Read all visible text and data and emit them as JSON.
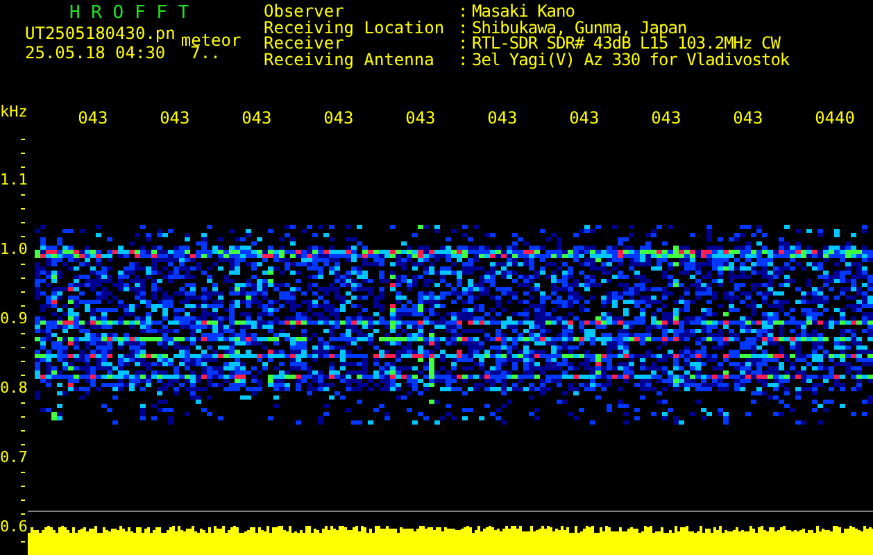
{
  "header": {
    "title": "H R O F F T",
    "file_name": "UT2505180430.pn",
    "event_type": "meteor",
    "date_time": "25.05.18 04:30",
    "count": "7.."
  },
  "station_info": [
    {
      "label": "Observer",
      "separator": ":",
      "value": "Masaki Kano"
    },
    {
      "label": "Receiving Location",
      "separator": ":",
      "value": "Shibukawa, Gunma, Japan"
    },
    {
      "label": "Receiver",
      "separator": ":",
      "value": "RTL-SDR SDR# 43dB L15 103.2MHz CW"
    },
    {
      "label": "Receiving Antenna",
      "separator": ":",
      "value": "3el Yagi(V) Az 330 for Vladivostok"
    }
  ],
  "y_axis": {
    "unit": "kHz",
    "labels": [
      "1.1",
      "1.0",
      "0.9",
      "0.8",
      "0.7",
      "0.6"
    ]
  },
  "time_labels": [
    "043",
    "043",
    "043",
    "043",
    "043",
    "043",
    "043",
    "043",
    "043",
    "0440"
  ]
}
